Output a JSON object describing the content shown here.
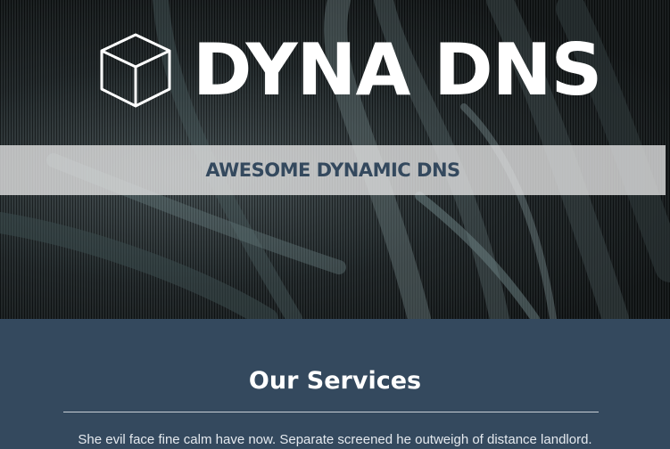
{
  "hero": {
    "brand_name": "DYNA DNS",
    "logo_icon": "cube-icon",
    "tagline": "AWESOME DYNAMIC DNS",
    "background": "network-cables-photo"
  },
  "services": {
    "title": "Our Services",
    "intro_text": "She evil face fine calm have now. Separate screened he outweigh of distance landlord."
  },
  "colors": {
    "page_background": "#34495e",
    "brand_text": "#ffffff",
    "tagline_text": "#34495e",
    "tagline_band": "#e6e6e6"
  }
}
